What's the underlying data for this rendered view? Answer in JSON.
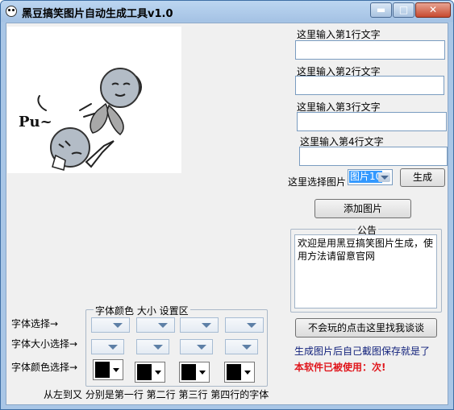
{
  "app": {
    "title": "黑豆搞笑图片自动生成工具v1.0"
  },
  "window_controls": {
    "minimize": "▬",
    "maximize": "□",
    "close": "✕"
  },
  "lines": {
    "line1_label": "这里输入第1行文字",
    "line2_label": "这里输入第2行文字",
    "line3_label": "这里输入第3行文字",
    "line4_label": "这里输入第4行文字",
    "line1_value": "",
    "line2_value": "",
    "line3_value": "",
    "line4_value": ""
  },
  "image_picker": {
    "label": "这里选择图片",
    "selected": "图片10",
    "generate_label": "生成"
  },
  "add_image_button": "添加图片",
  "notice": {
    "title": "公告",
    "text": "欢迎是用黑豆搞笑图片生成，使用方法请留意官网"
  },
  "meme": {
    "caption": "Pu~"
  },
  "font_settings": {
    "group_title": "字体颜色 大小 设置区",
    "font_row_label": "字体选择→",
    "size_row_label": "字体大小选择→",
    "color_row_label": "字体颜色选择→",
    "footer": "从左到又 分别是第一行 第二行 第三行 第四行的字体"
  },
  "help_button": "不会玩的点击这里找我谈谈",
  "info_text": "生成图片后自己截图保存就是了",
  "usage_text": "本软件已被使用：次!",
  "colors": {
    "title_bar": "#a9c6e6",
    "client_bg": "#f0f0f0",
    "usage_red": "#e0161c",
    "info_blue": "#0f1f7a"
  },
  "icons": [
    "app-face-icon",
    "minimize-icon",
    "maximize-icon",
    "close-icon",
    "dropdown-arrow-icon"
  ]
}
